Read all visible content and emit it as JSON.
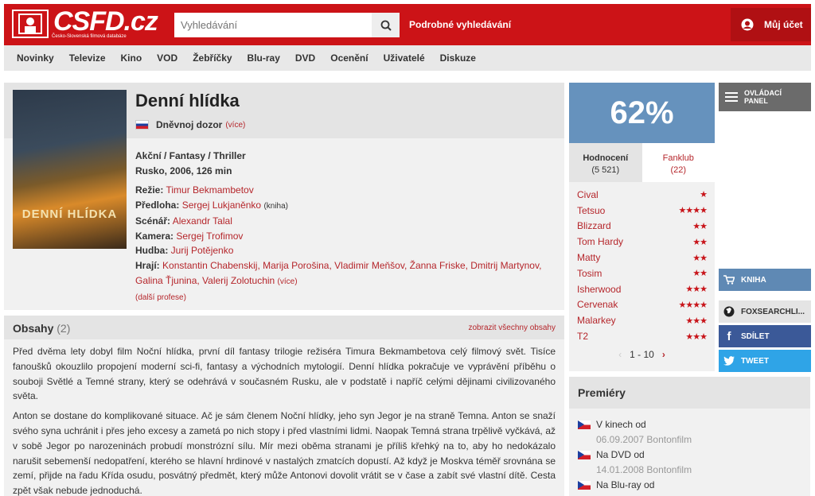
{
  "header": {
    "logo_text": "CSFD.cz",
    "logo_sub": "Česko-Slovenská filmová databáze",
    "search_placeholder": "Vyhledávání",
    "advanced_search": "Podrobné vyhledávání",
    "account": "Můj účet"
  },
  "nav": [
    "Novinky",
    "Televize",
    "Kino",
    "VOD",
    "Žebříčky",
    "Blu-ray",
    "DVD",
    "Ocenění",
    "Uživatelé",
    "Diskuze"
  ],
  "film": {
    "poster_title": "DENNÍ HLÍDKA",
    "title": "Denní hlídka",
    "original_title": "Dněvnoj dozor",
    "more": "(více)",
    "genre": "Akční / Fantasy / Thriller",
    "origin": "Rusko, 2006, 126 min",
    "crew": {
      "rezie_label": "Režie:",
      "rezie": "Timur Bekmambetov",
      "predloha_label": "Předloha:",
      "predloha": "Sergej Lukjaněnko",
      "predloha_note": "(kniha)",
      "scenar_label": "Scénář:",
      "scenar": "Alexandr Talal",
      "kamera_label": "Kamera:",
      "kamera": "Sergej Trofimov",
      "hudba_label": "Hudba:",
      "hudba": "Jurij Potějenko",
      "hraji_label": "Hrají:",
      "hraji": "Konstantin Chabenskij, Marija Porošina, Vladimir Meňšov, Žanna Friske, Dmitrij Martynov, Galina Ťjunina, Valerij Zolotuchin",
      "hraji_more": "(více)",
      "more_roles": "(další profese)"
    }
  },
  "plot": {
    "title": "Obsahy",
    "count": "(2)",
    "show_all": "zobrazit všechny obsahy",
    "p1": "Před dvěma lety dobyl film Noční hlídka, první díl fantasy trilogie režiséra Timura Bekmambetova celý filmový svět. Tisíce fanoušků okouzlilo propojení moderní sci-fi, fantasy a východních mytologií. Denní hlídka pokračuje ve vyprávění příběhu o souboji Světlé a Temné strany, který se odehrává v současném Rusku, ale v podstatě i napříč celými dějinami civilizovaného světa.",
    "p2": "Anton se dostane do komplikované situace. Ač je sám členem Noční hlídky, jeho syn Jegor je na straně Temna. Anton se snaží svého syna uchránit i přes jeho excesy a zametá po nich stopy i před vlastními lidmi. Naopak Temná strana trpělivě vyčkává, až v sobě Jegor po narozeninách probudí monstrózní sílu. Mír mezi oběma stranami je příliš křehký na to, aby ho nedokázalo narušit sebemenší nedopatření, kterého se hlavní hrdinové v nastalých zmatcích dopustí. Až když je Moskva téměř srovnána se zemí, přijde na řadu Křída osudu, posvátný předmět, který může Antonovi dovolit vrátit se v čase a zabít své vlastní dítě. Cesta zpět však nebude jednoduchá."
  },
  "rating": {
    "percent": "62%",
    "tab_hodnoceni": "Hodnocení",
    "tab_hodnoceni_count": "(5 521)",
    "tab_fanklub": "Fanklub",
    "tab_fanklub_count": "(22)",
    "users": [
      {
        "name": "Cival",
        "stars": 1
      },
      {
        "name": "Tetsuo",
        "stars": 4
      },
      {
        "name": "Blizzard",
        "stars": 2
      },
      {
        "name": "Tom Hardy",
        "stars": 2
      },
      {
        "name": "Matty",
        "stars": 2
      },
      {
        "name": "Tosim",
        "stars": 2
      },
      {
        "name": "Isherwood",
        "stars": 3
      },
      {
        "name": "Cervenak",
        "stars": 4
      },
      {
        "name": "Malarkey",
        "stars": 3
      },
      {
        "name": "T2",
        "stars": 3
      }
    ],
    "pager": "1 - 10"
  },
  "side": {
    "ctrl_line1": "OVLÁDACÍ",
    "ctrl_line2": "PANEL",
    "kniha": "KNIHA",
    "fox": "FOXSEARCHLI...",
    "fb": "SDÍLET",
    "tw": "TWEET"
  },
  "premiery": {
    "title": "Premiéry",
    "items": [
      {
        "label": "V kinech od",
        "date": "06.09.2007 Bontonfilm"
      },
      {
        "label": "Na DVD od",
        "date": "14.01.2008 Bontonfilm"
      },
      {
        "label": "Na Blu-ray od",
        "date": ""
      }
    ]
  },
  "colors": {
    "brand": "#cc1317",
    "rating": "#6692bd",
    "link": "#b5262b"
  }
}
